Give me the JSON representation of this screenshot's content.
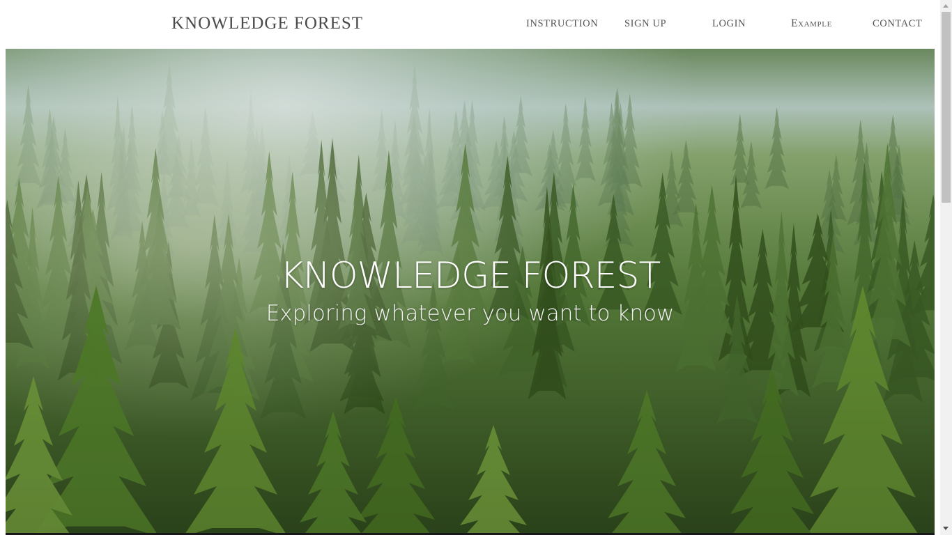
{
  "nav": {
    "brand": "KNOWLEDGE FOREST",
    "links": {
      "instruction": "INSTRUCTION",
      "signup": "SIGN UP",
      "login": "LOGIN",
      "example": "Example",
      "contact": "CONTACT"
    }
  },
  "hero": {
    "title": "KNOWLEDGE FOREST",
    "subtitle": "Exploring whatever you want to know",
    "background": "misty-pine-forest-image"
  },
  "colors": {
    "nav_background": "#ffffff",
    "nav_text": "#555555",
    "hero_text": "#ffffff",
    "forest_dark": "#2f4a22",
    "forest_light": "#7aa04a",
    "mist": "#cfe0e0"
  }
}
